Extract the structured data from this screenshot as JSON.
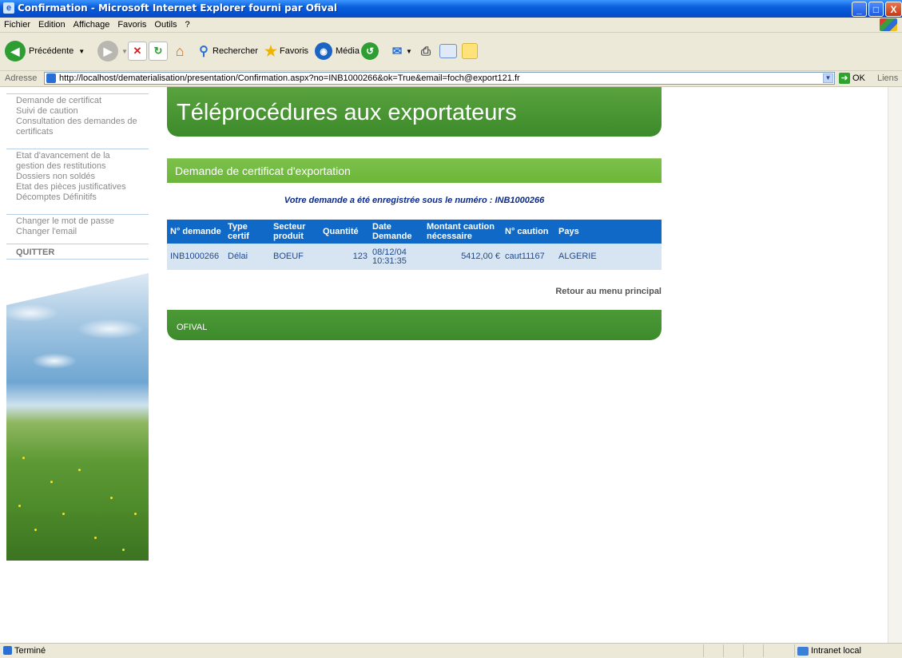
{
  "window": {
    "title": "Confirmation - Microsoft Internet Explorer fourni par Ofival",
    "controls": {
      "minimize": "_",
      "maximize": "□",
      "close": "X"
    }
  },
  "menubar": {
    "items": [
      "Fichier",
      "Edition",
      "Affichage",
      "Favoris",
      "Outils",
      "?"
    ]
  },
  "toolbar": {
    "back_label": "Précédente",
    "search_label": "Rechercher",
    "favorites_label": "Favoris",
    "media_label": "Média"
  },
  "addressbar": {
    "label": "Adresse",
    "url": "http://localhost/dematerialisation/presentation/Confirmation.aspx?no=INB1000266&ok=True&email=foch@export121.fr",
    "go_label": "OK",
    "links_label": "Liens"
  },
  "nav": {
    "group1": [
      "Demande de certificat",
      "Suivi de caution",
      "Consultation des demandes de certificats"
    ],
    "group2": [
      "Etat d'avancement de la gestion des restitutions",
      "Dossiers non soldés",
      "Etat des pièces justificatives",
      "Décomptes Définitifs"
    ],
    "group3": [
      "Changer le mot de passe",
      "Changer l'email"
    ],
    "quit": "QUITTER"
  },
  "page": {
    "banner_title": "Téléprocédures aux exportateurs",
    "section_title": "Demande de certificat d'exportation",
    "confirmation_message": "Votre demande a été enregistrée sous le numéro : INB1000266",
    "back_link": "Retour au menu principal",
    "footer_text": "OFIVAL"
  },
  "table": {
    "headers": [
      "N° demande",
      "Type certif",
      "Secteur produit",
      "Quantité",
      "Date Demande",
      "Montant caution nécessaire",
      "N° caution",
      "Pays"
    ],
    "rows": [
      [
        "INB1000266",
        "Délai",
        "BOEUF",
        "123",
        "08/12/04 10:31:35",
        "5412,00 €",
        "caut11167",
        "ALGERIE"
      ]
    ]
  },
  "statusbar": {
    "status": "Terminé",
    "zone": "Intranet local"
  },
  "colors": {
    "titlebar": "#0a5fdc",
    "banner_green": "#4c9a36",
    "subhead_green": "#72bb41",
    "table_header": "#1069c6",
    "table_row": "#d7e5f2",
    "message_blue": "#0a2a8a"
  }
}
